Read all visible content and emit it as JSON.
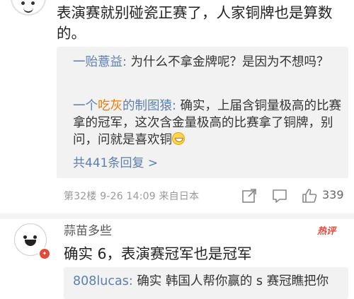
{
  "comment1": {
    "body": "表演赛就别碰瓷正赛了，人家铜牌也是算数的。",
    "replies": [
      {
        "user": "一贻薏益",
        "text": "为什么不拿金牌呢？是因为不想吗？"
      },
      {
        "user_prefix": "一个",
        "user_mid": "吃灰",
        "user_suffix": "的制图猿",
        "text": "确实，上届含铜量极高的比赛拿的冠军，这次含金量极高的比赛拿了铜牌，别问，问就是喜欢铜"
      }
    ],
    "more_replies": "共441条回复 >",
    "meta": "第32楼 9-26 14:09 来自日本",
    "likes": "339"
  },
  "comment2": {
    "user": "蒜苗多些",
    "hot_label": "热评",
    "body": "确实 6，表演赛冠军也是冠军",
    "reply": {
      "user": "808lucas",
      "text": "确实 韩国人帮你赢的 s 赛冠瞧把你"
    }
  },
  "icons": {
    "share": "share-icon",
    "comment": "comment-icon",
    "like": "thumbs-up-icon"
  },
  "colors": {
    "link": "#5b7fb0",
    "accent": "#f07a00",
    "hot": "#e04a3a"
  }
}
